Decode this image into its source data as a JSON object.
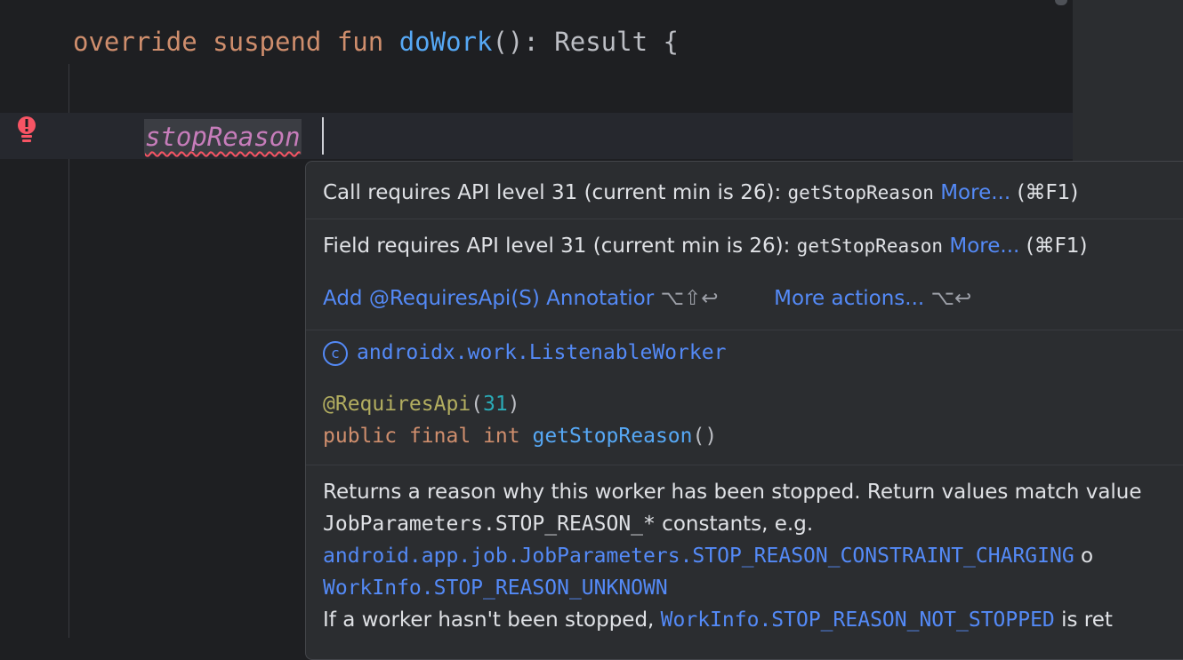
{
  "editor": {
    "code_override": "override",
    "code_suspend": "suspend",
    "code_fun": "fun",
    "code_fn_name": "doWork",
    "code_signature_rest": "(): Result {",
    "error_word": "stopReason"
  },
  "popup": {
    "msg1": {
      "text": "Call requires API level 31 (current min is 26):",
      "code": "getStopReason",
      "more": "More...",
      "shortcut": "(⌘F1)"
    },
    "msg2": {
      "text": "Field requires API level 31 (current min is 26):",
      "code": "getStopReason",
      "more": "More...",
      "shortcut": "(⌘F1)"
    },
    "actions": {
      "add_annotation": "Add @RequiresApi(S) Annotatior",
      "add_shortcut": "⌥⇧↩",
      "more_actions": "More actions...",
      "more_shortcut": "⌥↩"
    },
    "doc": {
      "class_icon_glyph": "c",
      "class_name": "androidx.work.ListenableWorker",
      "annotation": "@RequiresApi",
      "annotation_paren_open": "(",
      "annotation_value": "31",
      "annotation_paren_close": ")",
      "sig_public": "public",
      "sig_final": "final",
      "sig_int": "int",
      "sig_method": "getStopReason",
      "sig_parens": "()",
      "desc_line1": "Returns a reason why this worker has been stopped. Return values match value",
      "desc_line2_code": "JobParameters.STOP_REASON_*",
      "desc_line2_rest": " constants, e.g.",
      "desc_line3_link": "android.app.job.JobParameters.STOP_REASON_CONSTRAINT_CHARGING",
      "desc_line3_rest": " o",
      "desc_line4_link": "WorkInfo.STOP_REASON_UNKNOWN",
      "desc_line5_text": "If a worker hasn't been stopped, ",
      "desc_line5_link": "WorkInfo.STOP_REASON_NOT_STOPPED",
      "desc_line5_rest": " is ret"
    }
  },
  "colors": {
    "editor_bg": "#1e1f22",
    "popup_bg": "#2b2d30",
    "keyword": "#cf8e6d",
    "function": "#56a8f5",
    "link": "#548af7",
    "error": "#f75464",
    "annotation": "#b3ae60"
  }
}
